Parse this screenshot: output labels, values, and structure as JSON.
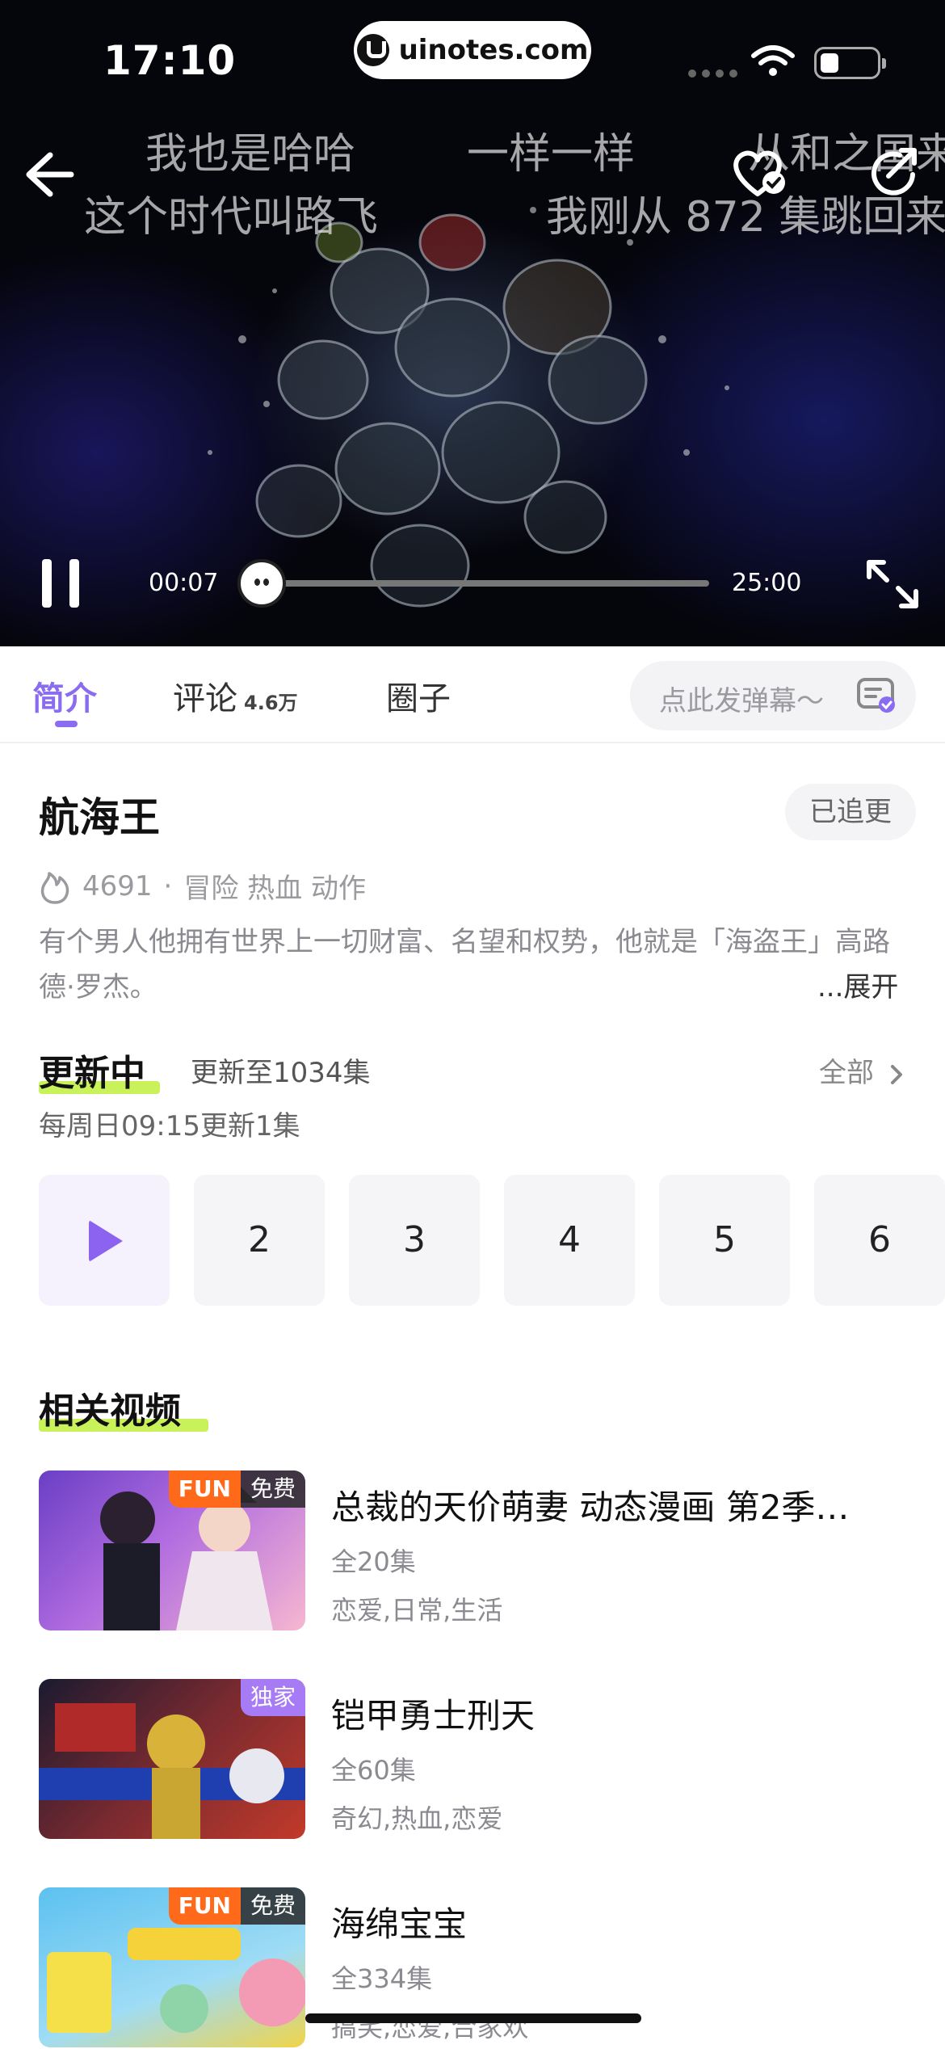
{
  "status_bar": {
    "time": "17:10",
    "url": "uinotes.com"
  },
  "video": {
    "danmaku": [
      "我也是哈哈",
      "一样一样",
      "从和之国来",
      "这个时代叫路飞",
      "我刚从 872 集跳回来"
    ],
    "current_time": "00:07",
    "total_time": "25:00",
    "progress": 0.0047
  },
  "tabs": {
    "items": [
      {
        "label": "简介"
      },
      {
        "label": "评论",
        "count": "4.6万"
      },
      {
        "label": "圈子"
      }
    ],
    "danmaku_placeholder": "点此发弹幕～"
  },
  "info": {
    "title": "航海王",
    "follow_label": "已追更",
    "heat": "4691",
    "dot": "·",
    "genres": "冒险 热血 动作",
    "description": "有个男人他拥有世界上一切财富、名望和权势，他就是「海盗王」高路德·罗杰。",
    "expand_label": "...展开"
  },
  "updating": {
    "title": "更新中",
    "subtitle": "更新至1034集",
    "all_label": "全部",
    "schedule": "每周日09:15更新1集",
    "episodes": [
      "2",
      "3",
      "4",
      "5",
      "6"
    ]
  },
  "related": {
    "title": "相关视频",
    "items": [
      {
        "title": "总裁的天价萌妻 动态漫画 第2季…",
        "episodes": "全20集",
        "tags": "恋爱,日常,生活",
        "badge_brand": "FUN",
        "badge_text": "免费",
        "thumb_color": "#8a5bd8"
      },
      {
        "title": "铠甲勇士刑天",
        "episodes": "全60集",
        "tags": "奇幻,热血,恋爱",
        "badge_brand": "",
        "badge_text": "独家",
        "thumb_color": "#c23a2a"
      },
      {
        "title": "海绵宝宝",
        "episodes": "全334集",
        "tags": "搞笑,恋爱,合家欢",
        "badge_brand": "FUN",
        "badge_text": "免费",
        "thumb_color": "#4fb3e8"
      }
    ]
  },
  "colors": {
    "accent": "#8a6cf0",
    "highlight": "#c9f25a",
    "badge_orange": "#ff6a1a"
  }
}
